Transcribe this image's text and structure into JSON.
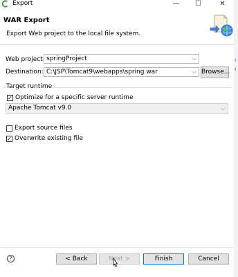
{
  "window": {
    "title": "Export",
    "minimize_glyph": "—",
    "maximize_glyph": "☐",
    "close_glyph": "✕"
  },
  "header": {
    "title": "WAR Export",
    "description": "Export Web project to the local file system."
  },
  "form": {
    "web_project_label": "Web project:",
    "web_project_value": "springProject",
    "destination_label": "Destination:",
    "destination_value": "C:\\JSP\\Tomcat9\\webapps\\spring.war",
    "browse_label": "Browse..."
  },
  "target_runtime": {
    "group_label": "Target runtime",
    "optimize_label": "Optimize for a specific server runtime",
    "optimize_checked": true,
    "runtime_value": "Apache Tomcat v9.0"
  },
  "options": {
    "export_source_label": "Export source files",
    "export_source_checked": false,
    "overwrite_label": "Overwrite existing file",
    "overwrite_checked": true
  },
  "buttons": {
    "help_glyph": "?",
    "back_label": "< Back",
    "next_label": "Next >",
    "finish_label": "Finish",
    "cancel_label": "Cancel"
  },
  "colors": {
    "default_button_border": "#0078d7",
    "button_face": "#e1e1e1"
  }
}
